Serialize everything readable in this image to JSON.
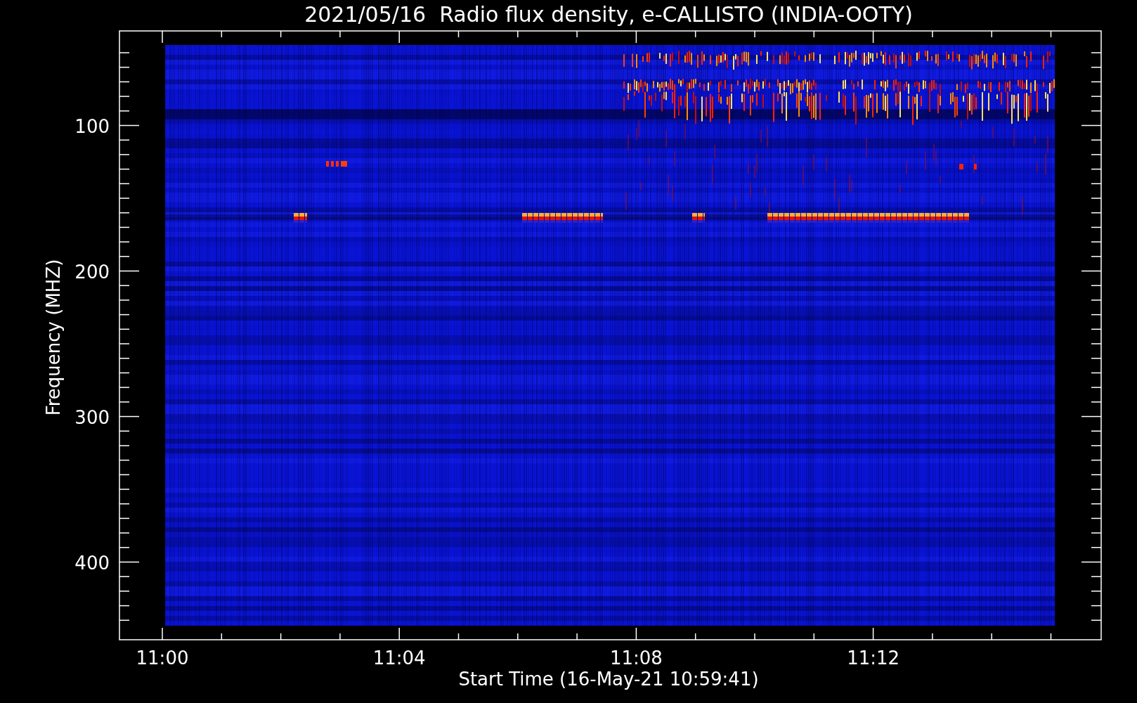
{
  "plot": {
    "title": "2021/05/16  Radio flux density, e-CALLISTO (INDIA-OOTY)",
    "xlabel": "Start Time (16-May-21 10:59:41)",
    "ylabel": "Frequency (MHZ)",
    "xtick_labels": [
      "11:00",
      "11:04",
      "11:08",
      "11:12"
    ],
    "ytick_labels": [
      "100",
      "200",
      "300",
      "400"
    ]
  }
}
